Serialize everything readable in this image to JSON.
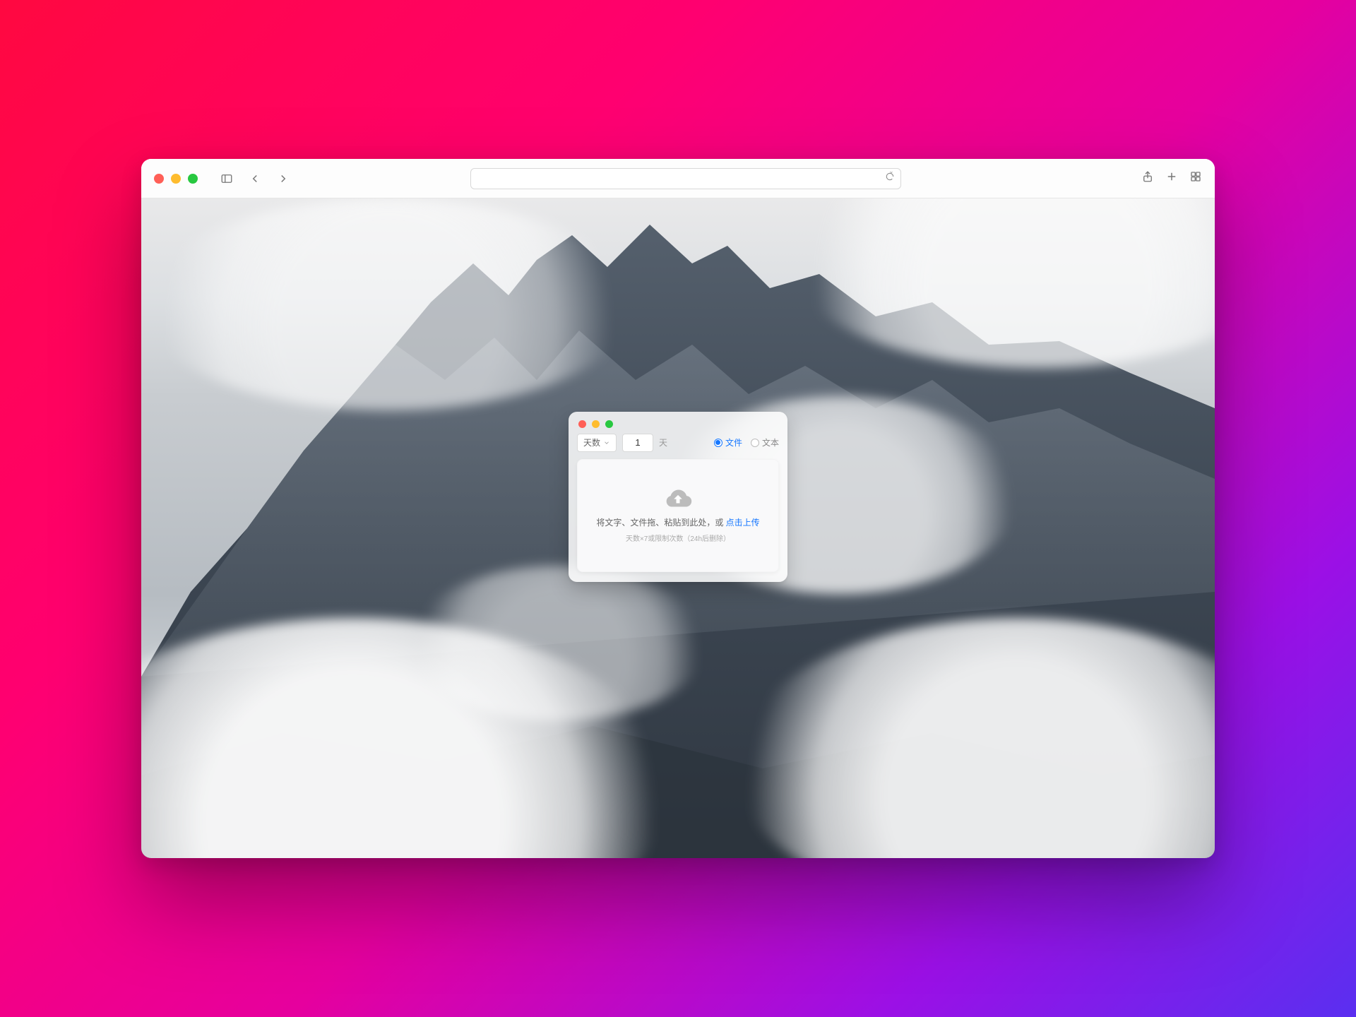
{
  "browser": {
    "url": "",
    "placeholder": ""
  },
  "widget": {
    "select_label": "天数",
    "number_value": "1",
    "unit": "天",
    "radio_file": "文件",
    "radio_text": "文本",
    "dropzone": {
      "line1_prefix": "将文字、文件拖、粘贴到此处，或 ",
      "link": "点击上传",
      "line2": "天数×7或限制次数（24h后删除）"
    }
  },
  "colors": {
    "accent": "#1677ff"
  }
}
